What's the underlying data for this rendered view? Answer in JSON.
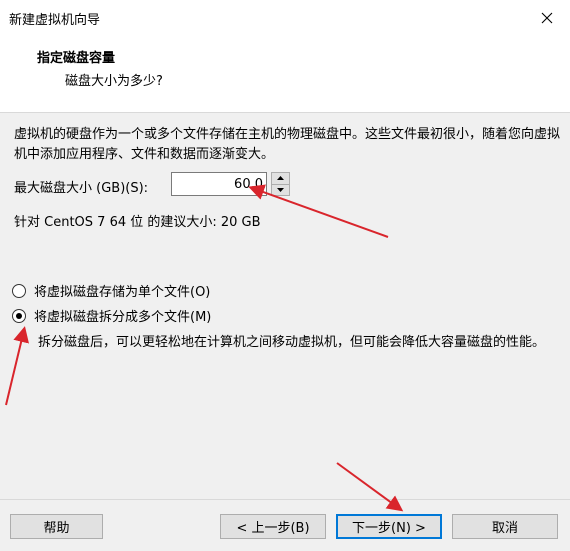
{
  "window": {
    "title": "新建虚拟机向导"
  },
  "header": {
    "title": "指定磁盘容量",
    "subtitle": "磁盘大小为多少?"
  },
  "description": "虚拟机的硬盘作为一个或多个文件存储在主机的物理磁盘中。这些文件最初很小，随着您向虚拟机中添加应用程序、文件和数据而逐渐变大。",
  "disk_size": {
    "label": "最大磁盘大小 (GB)(S):",
    "value": "60.0"
  },
  "recommendation": "针对 CentOS 7 64 位 的建议大小: 20 GB",
  "options": {
    "single_file": {
      "label": "将虚拟磁盘存储为单个文件(O)",
      "selected": false
    },
    "multiple_files": {
      "label": "将虚拟磁盘拆分成多个文件(M)",
      "selected": true,
      "description": "拆分磁盘后，可以更轻松地在计算机之间移动虚拟机，但可能会降低大容量磁盘的性能。"
    }
  },
  "buttons": {
    "help": "帮助",
    "back": "< 上一步(B)",
    "next": "下一步(N) >",
    "cancel": "取消"
  },
  "colors": {
    "annotation_arrow": "#d9252c",
    "default_button_border": "#0078d7"
  }
}
